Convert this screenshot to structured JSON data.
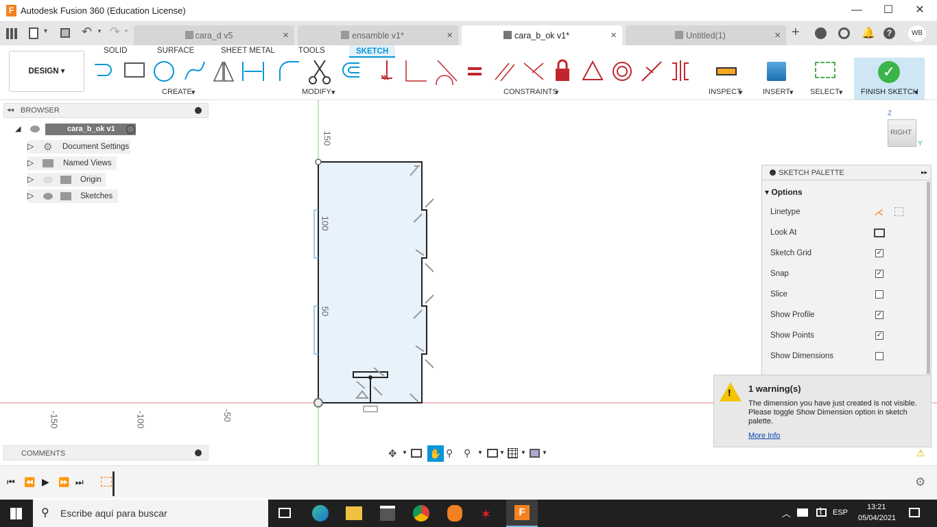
{
  "window": {
    "title": "Autodesk Fusion 360 (Education License)",
    "minimize": "—",
    "maximize": "☐",
    "close": "✕"
  },
  "tabs": [
    {
      "label": "cara_d v5"
    },
    {
      "label": "ensamble v1*"
    },
    {
      "label": "cara_b_ok v1*"
    },
    {
      "label": "Untitled(1)"
    }
  ],
  "user_initials": "WB",
  "toolbar": {
    "design_label": "DESIGN",
    "tabs": [
      "SOLID",
      "SURFACE",
      "SHEET METAL",
      "TOOLS",
      "SKETCH"
    ],
    "groups": [
      "CREATE",
      "MODIFY",
      "CONSTRAINTS",
      "INSPECT",
      "INSERT",
      "SELECT",
      "FINISH SKETCH"
    ]
  },
  "browser": {
    "title": "BROWSER",
    "root": "cara_b_ok v1",
    "items": [
      "Document Settings",
      "Named Views",
      "Origin",
      "Sketches"
    ]
  },
  "comments_label": "COMMENTS",
  "viewcube_label": "RIGHT",
  "axis_labels": {
    "z": "Z",
    "y": "Y"
  },
  "rulers": {
    "vertical": [
      "150",
      "100",
      "50"
    ],
    "horizontal": [
      "-150",
      "-100",
      "-50"
    ]
  },
  "palette": {
    "title": "SKETCH PALETTE",
    "section": "Options",
    "rows": [
      {
        "label": "Linetype"
      },
      {
        "label": "Look At"
      },
      {
        "label": "Sketch Grid",
        "checked": true
      },
      {
        "label": "Snap",
        "checked": true
      },
      {
        "label": "Slice",
        "checked": false
      },
      {
        "label": "Show Profile",
        "checked": true
      },
      {
        "label": "Show Points",
        "checked": true
      },
      {
        "label": "Show Dimensions",
        "checked": false
      }
    ]
  },
  "warning": {
    "title": "1 warning(s)",
    "message": "The dimension you have just created is not visible. Please toggle Show Dimension option in sketch palette.",
    "link": "More Info"
  },
  "taskbar": {
    "search_placeholder": "Escribe aquí para buscar",
    "language": "ESP",
    "time": "13:21",
    "date": "05/04/2021"
  },
  "colors": {
    "accent": "#0696d7",
    "finish_bg": "#cfe6f5",
    "sketch_fill": "#e8f2fb"
  }
}
